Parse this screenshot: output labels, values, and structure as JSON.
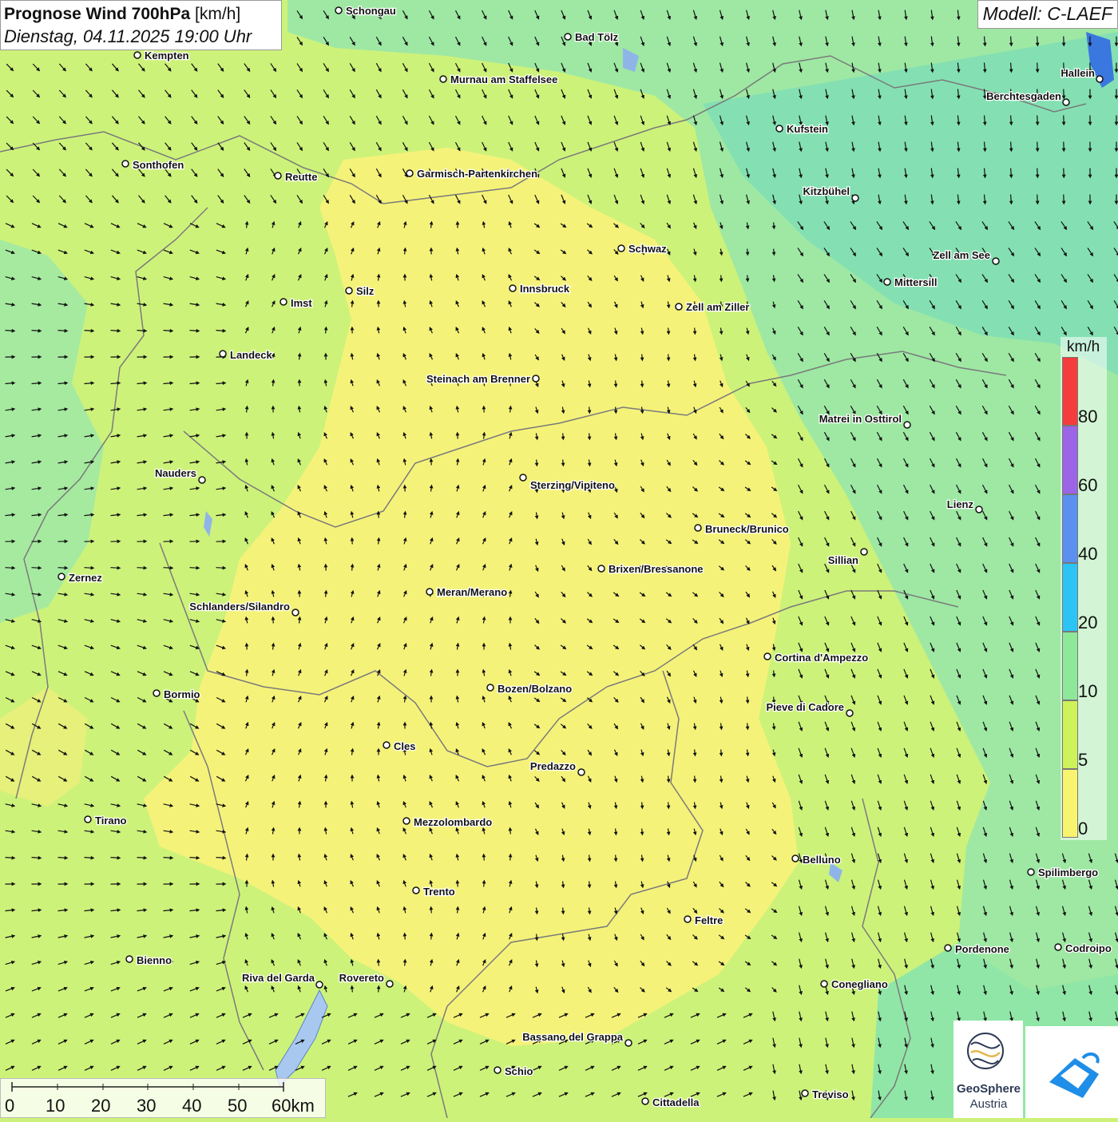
{
  "header": {
    "title_bold": "Prognose Wind 700hPa",
    "title_unit": "[km/h]",
    "datetime": "Dienstag, 04.11.2025 19:00 Uhr",
    "model": "Modell: C-LAEF"
  },
  "legend": {
    "unit": "km/h",
    "items": [
      {
        "label": "80",
        "color": "#f43c3c"
      },
      {
        "label": "60",
        "color": "#9c64e6"
      },
      {
        "label": "40",
        "color": "#5a90ef"
      },
      {
        "label": "20",
        "color": "#2cc4f4"
      },
      {
        "label": "10",
        "color": "#8ee89a"
      },
      {
        "label": "5",
        "color": "#cdf25a"
      },
      {
        "label": "0",
        "color": "#f9f46e"
      }
    ]
  },
  "scalebar": {
    "labels": [
      "0",
      "10",
      "20",
      "30",
      "40",
      "50",
      "60km"
    ]
  },
  "logos": {
    "geosphere_line1": "GeoSphere",
    "geosphere_line2": "Austria"
  },
  "cities": [
    {
      "name": "Schongau"
    },
    {
      "name": "Bad Tölz"
    },
    {
      "name": "Kempten"
    },
    {
      "name": "Murnau am Staffelsee"
    },
    {
      "name": "Hallein"
    },
    {
      "name": "Berchtesgaden"
    },
    {
      "name": "Kufstein"
    },
    {
      "name": "Sonthofen"
    },
    {
      "name": "Reutte"
    },
    {
      "name": "Garmisch-Partenkirchen"
    },
    {
      "name": "Kitzbühel"
    },
    {
      "name": "Schwaz"
    },
    {
      "name": "Zell am See"
    },
    {
      "name": "Mittersill"
    },
    {
      "name": "Innsbruck"
    },
    {
      "name": "Silz"
    },
    {
      "name": "Imst"
    },
    {
      "name": "Zell am Ziller"
    },
    {
      "name": "Landeck"
    },
    {
      "name": "Steinach am Brenner"
    },
    {
      "name": "Matrei in Osttirol"
    },
    {
      "name": "Nauders"
    },
    {
      "name": "Sterzing/Vipiteno"
    },
    {
      "name": "Lienz"
    },
    {
      "name": "Bruneck/Brunico"
    },
    {
      "name": "Sillian"
    },
    {
      "name": "Brixen/Bressanone"
    },
    {
      "name": "Zernez"
    },
    {
      "name": "Meran/Merano"
    },
    {
      "name": "Schlanders/Silandro"
    },
    {
      "name": "Cortina d'Ampezzo"
    },
    {
      "name": "Bozen/Bolzano"
    },
    {
      "name": "Bormio"
    },
    {
      "name": "Pieve di Cadore"
    },
    {
      "name": "Cles"
    },
    {
      "name": "Predazzo"
    },
    {
      "name": "Tirano"
    },
    {
      "name": "Mezzolombardo"
    },
    {
      "name": "Belluno"
    },
    {
      "name": "Spilimbergo"
    },
    {
      "name": "Trento"
    },
    {
      "name": "Feltre"
    },
    {
      "name": "Pordenone"
    },
    {
      "name": "Codroipo"
    },
    {
      "name": "Bienno"
    },
    {
      "name": "Riva del Garda"
    },
    {
      "name": "Rovereto"
    },
    {
      "name": "Conegliano"
    },
    {
      "name": "Bassano del Grappa"
    },
    {
      "name": "Schio"
    },
    {
      "name": "Treviso"
    },
    {
      "name": "Cittadella"
    }
  ]
}
